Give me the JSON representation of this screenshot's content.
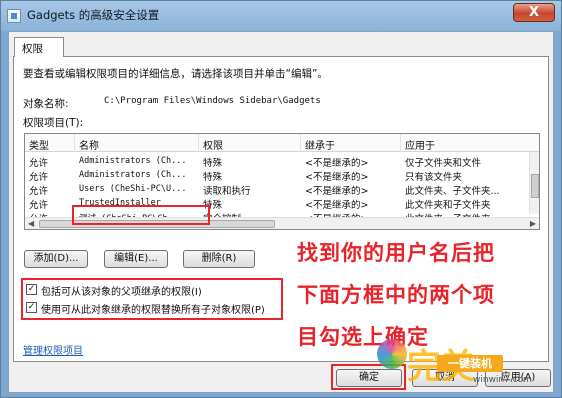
{
  "window": {
    "title": "Gadgets 的高级安全设置",
    "close_label": "X"
  },
  "tab": {
    "label": "权限"
  },
  "instruction": "要查看或编辑权限项目的详细信息，请选择该项目并单击“编辑”。",
  "object": {
    "label": "对象名称:",
    "value": "C:\\Program Files\\Windows Sidebar\\Gadgets"
  },
  "entries": {
    "label": "权限项目(T):",
    "columns": [
      "类型",
      "名称",
      "权限",
      "继承于",
      "应用于"
    ],
    "rows": [
      {
        "type": "允许",
        "name": "Administrators (Ch...",
        "permission": "特殊",
        "inherited": "<不是继承的>",
        "applies": "仅子文件夹和文件"
      },
      {
        "type": "允许",
        "name": "Administrators (Ch...",
        "permission": "特殊",
        "inherited": "<不是继承的>",
        "applies": "只有该文件夹"
      },
      {
        "type": "允许",
        "name": "Users (CheShi-PC\\U...",
        "permission": "读取和执行",
        "inherited": "<不是继承的>",
        "applies": "此文件夹、子文件夹..."
      },
      {
        "type": "允许",
        "name": "TrustedInstaller",
        "permission": "特殊",
        "inherited": "<不是继承的>",
        "applies": "此文件夹和子文件夹"
      },
      {
        "type": "允许",
        "name": "测试 (CheShi-PC\\Ch...",
        "permission": "完全控制",
        "inherited": "<不是继承的>",
        "applies": "此文件夹、子文件夹..."
      }
    ]
  },
  "buttons": {
    "add": "添加(D)...",
    "edit": "编辑(E)...",
    "remove": "删除(R)",
    "ok": "确定",
    "cancel": "取消",
    "apply": "应用(A)"
  },
  "checkboxes": [
    {
      "label": "包括可从该对象的父项继承的权限(I)",
      "checked": true
    },
    {
      "label": "使用可从此对象继承的权限替换所有子对象权限(P)",
      "checked": true
    }
  ],
  "link": "管理权限项目",
  "annotation": {
    "lines": [
      "找到你的用户名后把",
      "下面方框中的两个项",
      "目勾选上确定"
    ],
    "color": "#e8232a"
  },
  "watermark": {
    "brand": "完美",
    "badge": "一键装机",
    "url": "winwin7.com"
  }
}
